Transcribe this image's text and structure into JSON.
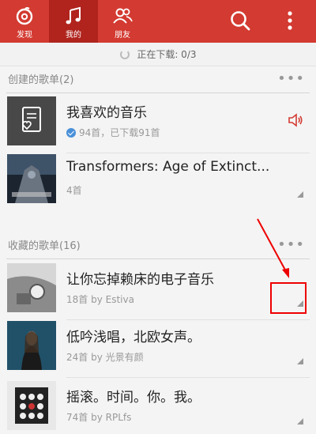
{
  "nav": {
    "tabs": [
      {
        "label": "发现",
        "icon": "netease-music-logo-icon"
      },
      {
        "label": "我的",
        "icon": "music-note-icon"
      },
      {
        "label": "朋友",
        "icon": "friends-icon"
      }
    ],
    "active_tab": "我的"
  },
  "download_status": "正在下载: 0/3",
  "created_section": {
    "title": "创建的歌单(2)",
    "playlists": [
      {
        "title": "我喜欢的音乐",
        "subtitle": "94首，已下载91首",
        "status_icon": "speaker-icon"
      },
      {
        "title": "Transformers: Age of Extinct...",
        "subtitle": "4首"
      }
    ]
  },
  "collected_section": {
    "title": "收藏的歌单(16)",
    "playlists": [
      {
        "title": "让你忘掉赖床的电子音乐",
        "subtitle": "18首 by Estiva"
      },
      {
        "title": "低吟浅唱，北欧女声。",
        "subtitle": "24首 by 光景有颜"
      },
      {
        "title": "摇滚。时间。你。我。",
        "subtitle": "74首 by RPLfs"
      }
    ]
  },
  "colors": {
    "brand": "#d33a31",
    "annotation": "#e00000",
    "check": "#4a90d9"
  }
}
